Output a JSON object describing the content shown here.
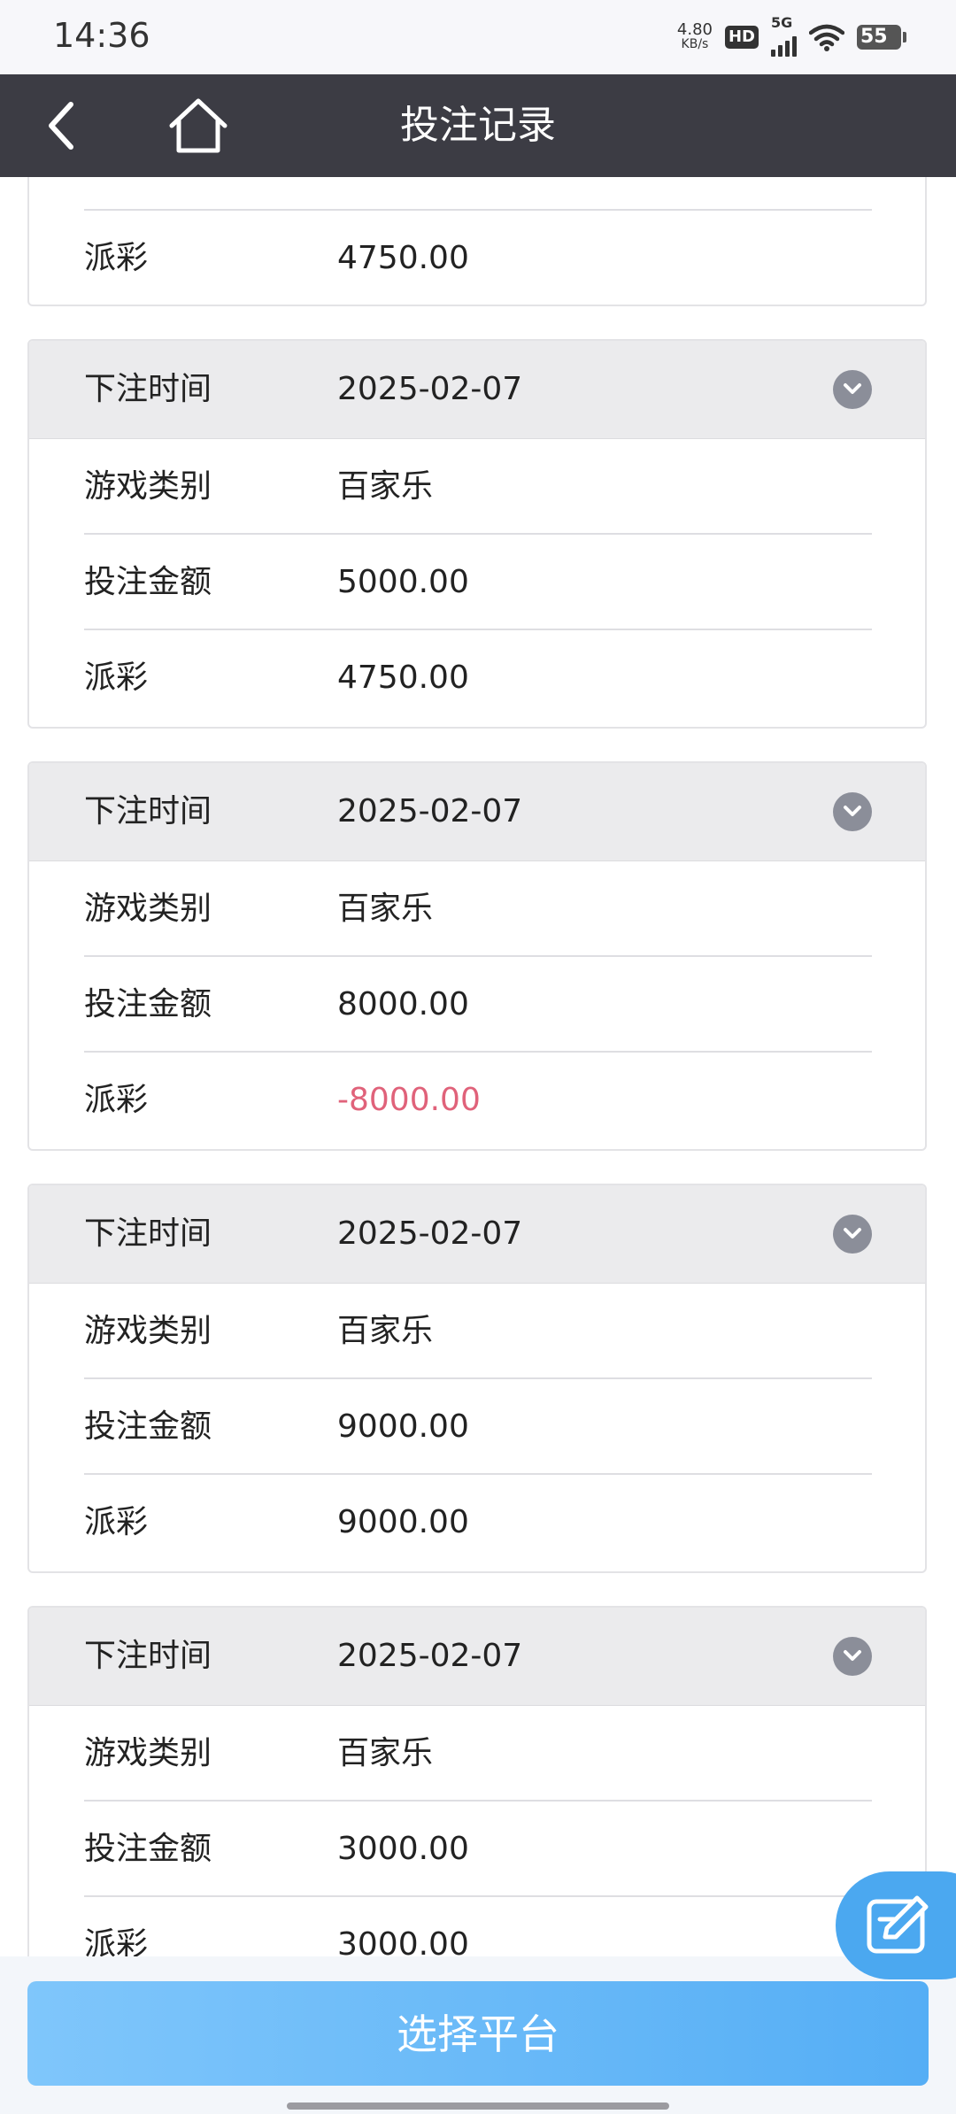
{
  "status_bar": {
    "time": "14:36",
    "net_speed_value": "4.80",
    "net_speed_unit": "KB/s",
    "hd": "HD",
    "network": "5G",
    "battery": "55"
  },
  "nav": {
    "title": "投注记录"
  },
  "partial_card": {
    "label": "派彩",
    "value": "4750.00"
  },
  "labels": {
    "time": "下注时间",
    "game": "游戏类别",
    "amount": "投注金额",
    "payout": "派彩"
  },
  "records": [
    {
      "time": "2025-02-07",
      "game": "百家乐",
      "amount": "5000.00",
      "payout": "4750.00"
    },
    {
      "time": "2025-02-07",
      "game": "百家乐",
      "amount": "8000.00",
      "payout": "-8000.00"
    },
    {
      "time": "2025-02-07",
      "game": "百家乐",
      "amount": "9000.00",
      "payout": "9000.00"
    },
    {
      "time": "2025-02-07",
      "game": "百家乐",
      "amount": "3000.00",
      "payout": "3000.00"
    }
  ],
  "footer": {
    "select_platform": "选择平台"
  },
  "colors": {
    "nav_bg": "#3c3c44",
    "negative": "#e0627a",
    "button_gradient_start": "#7fc6fb",
    "button_gradient_end": "#55aef5"
  }
}
